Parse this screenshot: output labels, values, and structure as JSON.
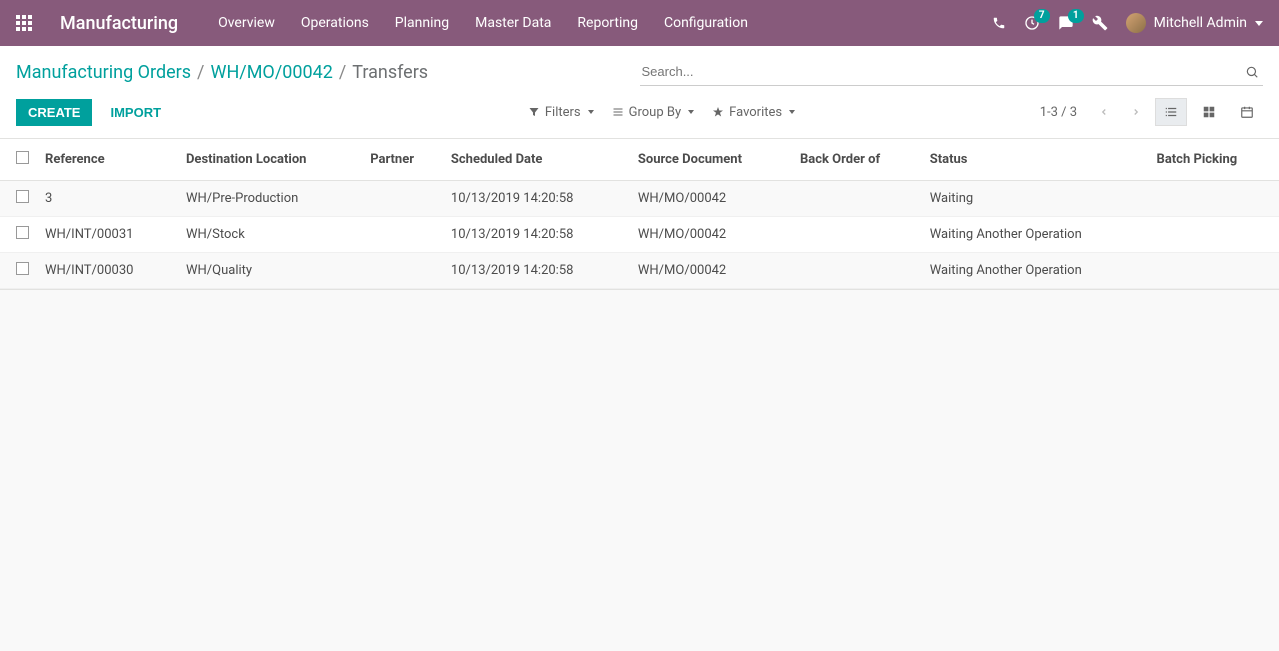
{
  "nav": {
    "app_title": "Manufacturing",
    "menu": [
      "Overview",
      "Operations",
      "Planning",
      "Master Data",
      "Reporting",
      "Configuration"
    ],
    "activities_badge": "7",
    "messages_badge": "1",
    "user_name": "Mitchell Admin"
  },
  "breadcrumb": {
    "items": [
      "Manufacturing Orders",
      "WH/MO/00042"
    ],
    "current": "Transfers"
  },
  "search": {
    "placeholder": "Search..."
  },
  "buttons": {
    "create": "Create",
    "import": "Import"
  },
  "toolbar": {
    "filters": "Filters",
    "group_by": "Group By",
    "favorites": "Favorites"
  },
  "pager": {
    "range": "1-3 / 3"
  },
  "table": {
    "headers": {
      "reference": "Reference",
      "dest": "Destination Location",
      "partner": "Partner",
      "scheduled": "Scheduled Date",
      "source": "Source Document",
      "back_order": "Back Order of",
      "status": "Status",
      "batch": "Batch Picking"
    },
    "rows": [
      {
        "reference": "3",
        "dest": "WH/Pre-Production",
        "partner": "",
        "scheduled": "10/13/2019 14:20:58",
        "source": "WH/MO/00042",
        "back_order": "",
        "status": "Waiting",
        "batch": ""
      },
      {
        "reference": "WH/INT/00031",
        "dest": "WH/Stock",
        "partner": "",
        "scheduled": "10/13/2019 14:20:58",
        "source": "WH/MO/00042",
        "back_order": "",
        "status": "Waiting Another Operation",
        "batch": ""
      },
      {
        "reference": "WH/INT/00030",
        "dest": "WH/Quality",
        "partner": "",
        "scheduled": "10/13/2019 14:20:58",
        "source": "WH/MO/00042",
        "back_order": "",
        "status": "Waiting Another Operation",
        "batch": ""
      }
    ]
  }
}
